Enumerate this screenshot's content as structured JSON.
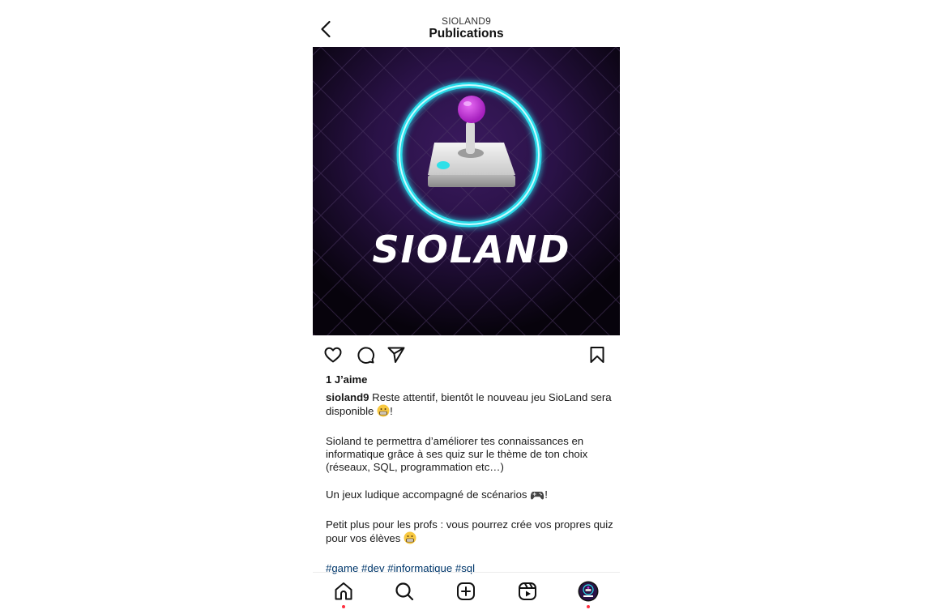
{
  "header": {
    "username": "SIOLAND9",
    "title": "Publications"
  },
  "post": {
    "image_text": "SIOLAND",
    "likes": "1 J’aime",
    "author": "sioland9",
    "caption_line1": " Reste attentif, bientôt le nouveau jeu SioLand sera disponible ",
    "caption_line1_end": "!",
    "paragraph2": "Sioland te permettra d’améliorer tes connaissances en informatique grâce à ses quiz sur le thème de ton choix (réseaux, SQL, programmation etc…)",
    "paragraph3": "Un jeux ludique accompagné de scénarios ",
    "paragraph3_end": "!",
    "paragraph4": "Petit plus pour les profs : vous pourrez crée vos propres quiz pour vos élèves ",
    "hashtags": [
      "#game",
      "#dev",
      "#informatique",
      "#sql"
    ]
  },
  "icons": {
    "back": "chevron-left-icon",
    "like": "heart-icon",
    "comment": "comment-icon",
    "share": "send-icon",
    "save": "bookmark-icon",
    "nav": [
      "home-icon",
      "search-icon",
      "plus-square-icon",
      "reels-icon",
      "profile-avatar"
    ]
  },
  "colors": {
    "notification_dot": "#ff3040",
    "hashtag": "#00376b",
    "neon_cyan": "#29e6f2",
    "joystick_purple": "#c23bd9"
  }
}
